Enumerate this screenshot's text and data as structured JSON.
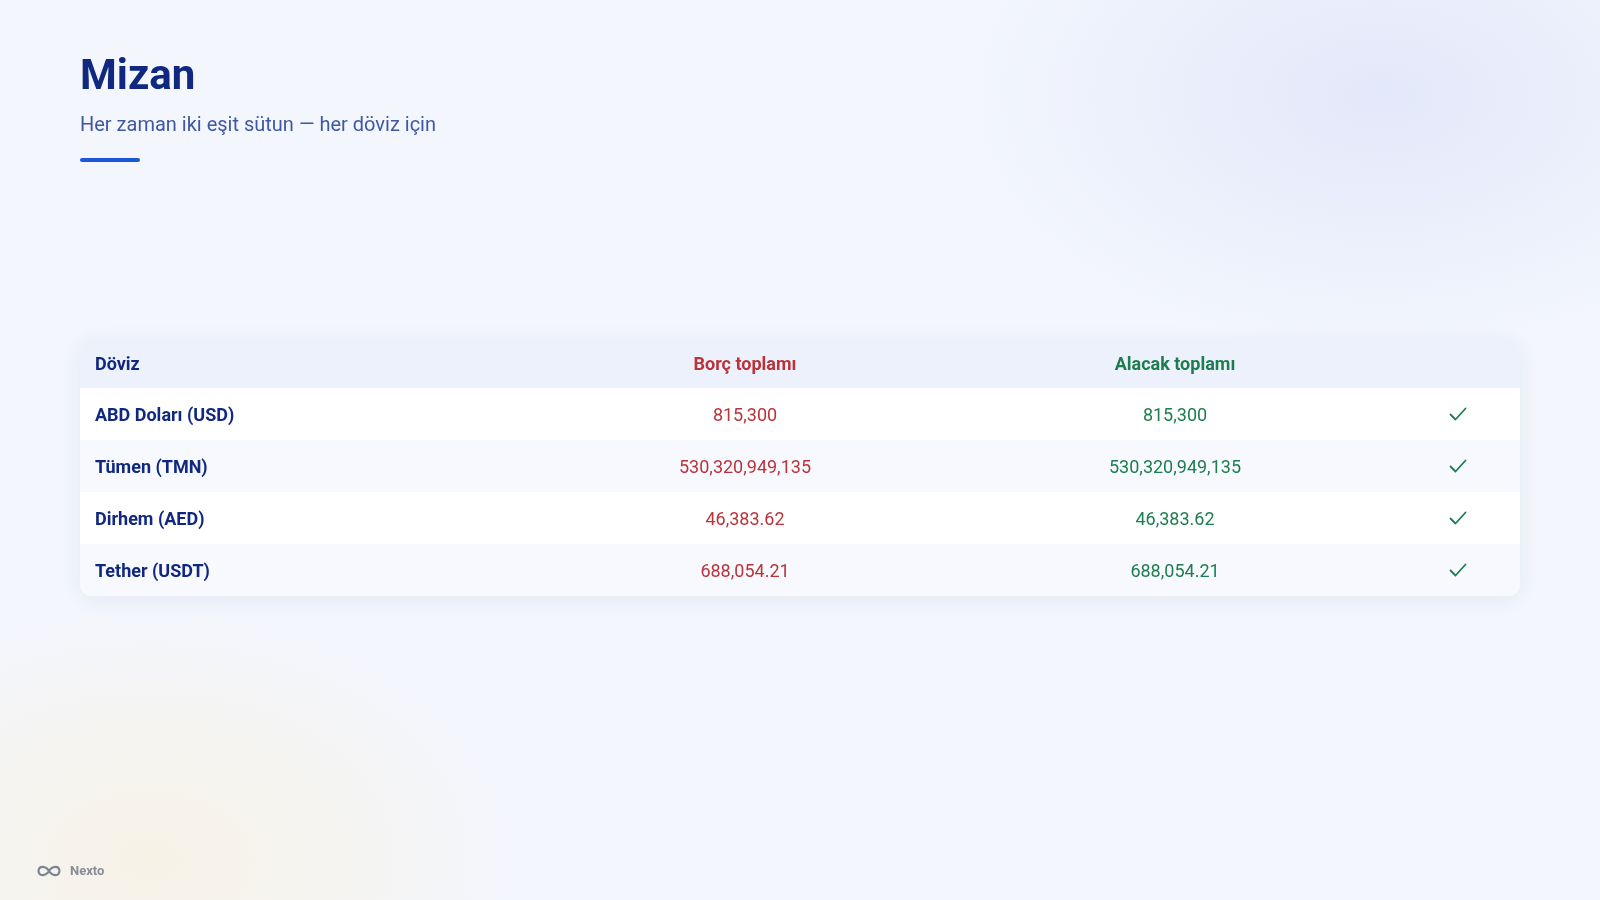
{
  "header": {
    "title": "Mizan",
    "subtitle": "Her zaman iki eşit sütun — her döviz için"
  },
  "table": {
    "columns": [
      "Döviz",
      "Borç toplamı",
      "Alacak toplamı"
    ],
    "rows": [
      {
        "currency": "ABD Doları (USD)",
        "debit": "815,300",
        "credit": "815,300",
        "balanced": true
      },
      {
        "currency": "Tümen (TMN)",
        "debit": "530,320,949,135",
        "credit": "530,320,949,135",
        "balanced": true
      },
      {
        "currency": "Dirhem (AED)",
        "debit": "46,383.62",
        "credit": "46,383.62",
        "balanced": true
      },
      {
        "currency": "Tether (USDT)",
        "debit": "688,054.21",
        "credit": "688,054.21",
        "balanced": true
      }
    ]
  },
  "footer": {
    "brand": "Nexto"
  }
}
